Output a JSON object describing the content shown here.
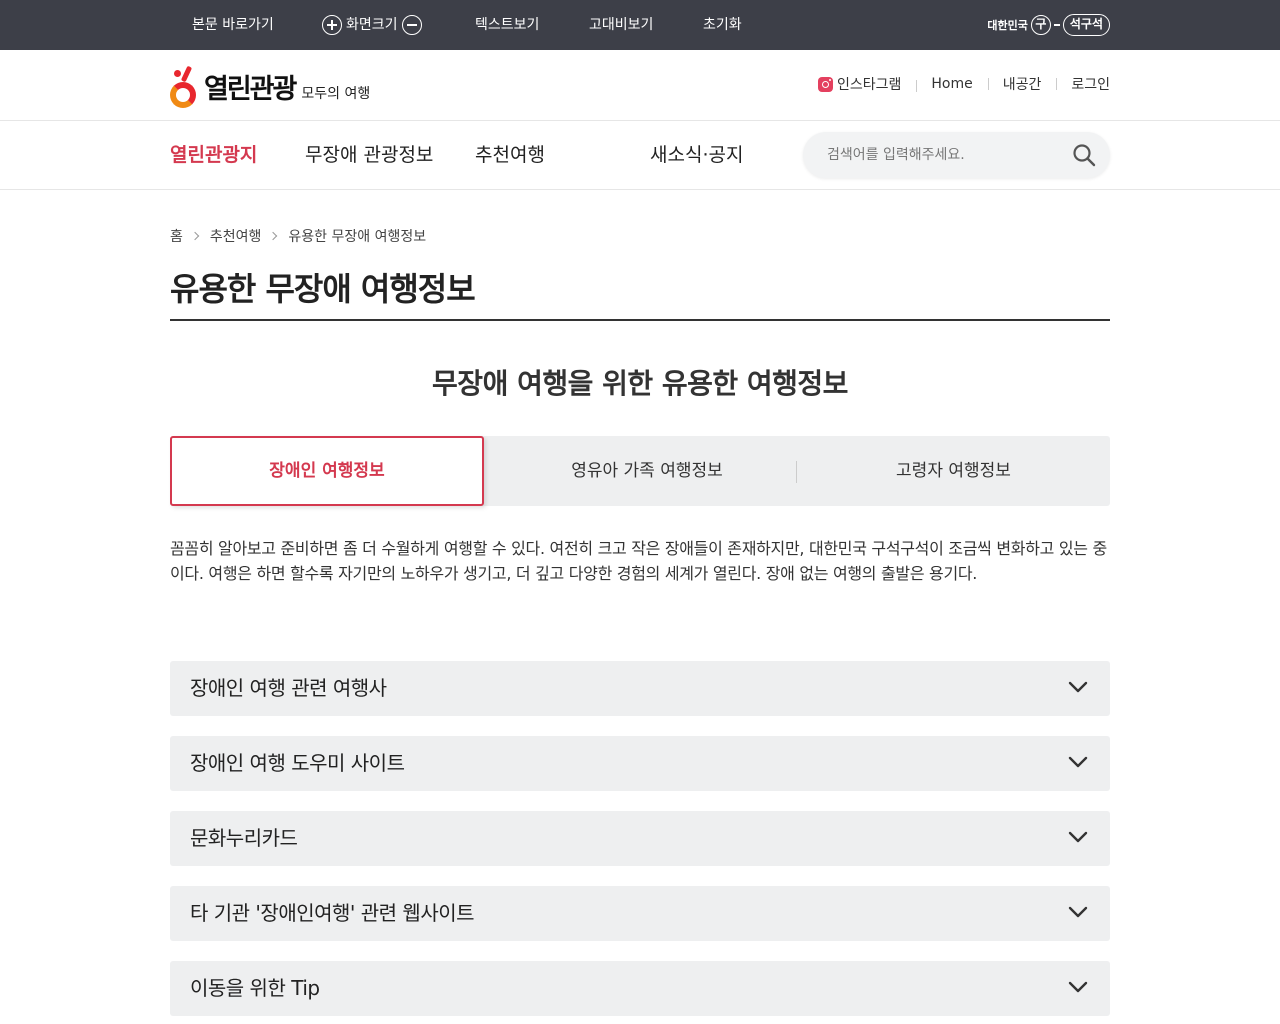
{
  "utility_bar": {
    "skip_link": "본문 바로가기",
    "screen_size": "화면크기",
    "text_view": "텍스트보기",
    "high_contrast": "고대비보기",
    "reset": "초기화",
    "gov_logo": {
      "country": "대한민국",
      "mark": "구",
      "slogan": "석구석"
    }
  },
  "header": {
    "logo_text": "열린관광",
    "logo_sub": "모두의 여행",
    "links": [
      "인스타그램",
      "Home",
      "내공간",
      "로그인"
    ]
  },
  "gnb": {
    "items": [
      "열린관광지",
      "무장애 관광정보",
      "추천여행",
      "새소식·공지"
    ],
    "search_placeholder": "검색어를 입력해주세요."
  },
  "breadcrumb": [
    "홈",
    "추천여행",
    "유용한 무장애 여행정보"
  ],
  "page_title": "유용한 무장애 여행정보",
  "section_title": "무장애 여행을 위한 유용한 여행정보",
  "tabs": [
    "장애인 여행정보",
    "영유아 가족 여행정보",
    "고령자 여행정보"
  ],
  "intro": "꼼꼼히 알아보고 준비하면 좀 더 수월하게 여행할 수 있다. 여전히 크고 작은 장애들이 존재하지만, 대한민국 구석구석이 조금씩 변화하고 있는 중이다. 여행은 하면 할수록 자기만의 노하우가 생기고, 더 깊고 다양한 경험의 세계가 열린다. 장애 없는 여행의 출발은 용기다.",
  "accordion": [
    "장애인 여행 관련 여행사",
    "장애인 여행 도우미 사이트",
    "문화누리카드",
    "타 기관 '장애인여행' 관련 웹사이트",
    "이동을 위한 Tip"
  ],
  "colors": {
    "accent": "#d4394f",
    "utility_bg": "#3d3f48",
    "panel_bg": "#eeeff0"
  }
}
